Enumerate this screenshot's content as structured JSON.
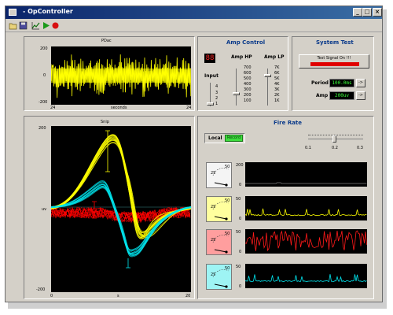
{
  "window": {
    "title": "- OpController",
    "min_btn": "_",
    "max_btn": "□",
    "close_btn": "×"
  },
  "toolbar": {
    "icons": [
      "open-icon",
      "save-icon",
      "chart-icon",
      "play-icon",
      "record-icon"
    ]
  },
  "pdac": {
    "title": "PDac",
    "y_top": "200",
    "y_mid": "0",
    "y_bottom": "-200",
    "x_left": "24",
    "x_center": "seconds",
    "x_right": "24",
    "trace_color": "#ffff00"
  },
  "amp_control": {
    "title": "Amp Control",
    "display_value": "88",
    "input_label": "Input",
    "input_options": [
      "4",
      "3",
      "2",
      "1"
    ],
    "hp_label": "Amp HP",
    "hp_options": [
      "700",
      "600",
      "500",
      "400",
      "300",
      "200",
      "100"
    ],
    "lp_label": "Amp LP",
    "lp_options": [
      "7K",
      "6K",
      "5K",
      "4K",
      "3K",
      "2K",
      "1K"
    ]
  },
  "system_test": {
    "title": "System Test",
    "button_label": "Test Signal On !!!",
    "indicator_color": "#e00000",
    "period_label": "Period",
    "period_value": "100.0ms",
    "amp_label": "Amp",
    "amp_value": "200uv",
    "arrow": "->"
  },
  "snip": {
    "title": "Snip",
    "y_top": "200",
    "y_mid": "uv",
    "y_bottom": "-200",
    "x_left": "0",
    "x_center": "s",
    "x_right": "20",
    "colors": {
      "yellow": "#ffff00",
      "cyan": "#00e5ee",
      "red": "#ff0000"
    }
  },
  "fire_rate": {
    "title": "Fire Rate",
    "local_label": "Local",
    "record_label": "Record",
    "slider_ticks": [
      "0.1",
      "0.2",
      "0.3"
    ],
    "gauge_ticks": [
      "25",
      "50"
    ],
    "channels": [
      {
        "name": "white",
        "bg": "#f4f4f4",
        "y_top": "200",
        "y_bottom": "0",
        "trace": "#808080"
      },
      {
        "name": "yellow",
        "bg": "#ffff9e",
        "y_top": "50",
        "y_bottom": "0",
        "trace": "#ffff00"
      },
      {
        "name": "red",
        "bg": "#ff9e9e",
        "y_top": "50",
        "y_bottom": "0",
        "trace": "#ff1a1a"
      },
      {
        "name": "cyan",
        "bg": "#9ef4f4",
        "y_top": "50",
        "y_bottom": "0",
        "trace": "#00e5ee"
      }
    ]
  }
}
